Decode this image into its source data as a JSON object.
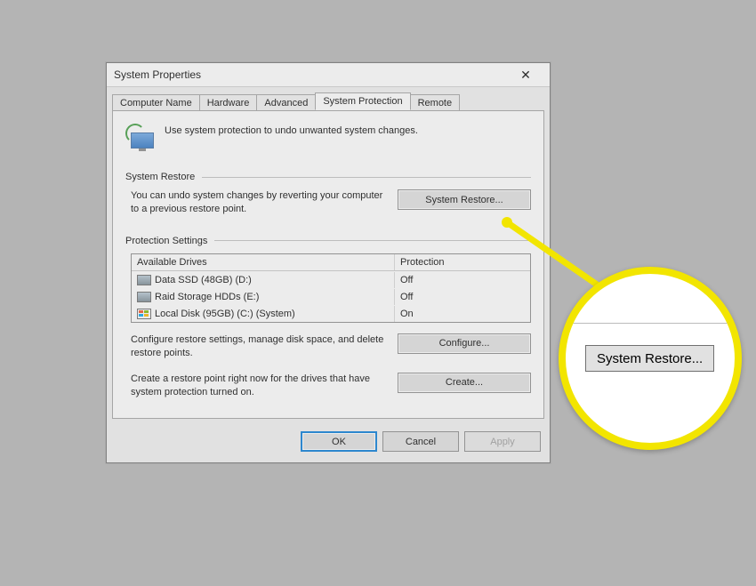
{
  "window": {
    "title": "System Properties",
    "close_aria": "Close"
  },
  "tabs": [
    {
      "label": "Computer Name",
      "active": false
    },
    {
      "label": "Hardware",
      "active": false
    },
    {
      "label": "Advanced",
      "active": false
    },
    {
      "label": "System Protection",
      "active": true
    },
    {
      "label": "Remote",
      "active": false
    }
  ],
  "intro": {
    "text": "Use system protection to undo unwanted system changes."
  },
  "restore": {
    "title": "System Restore",
    "desc": "You can undo system changes by reverting your computer to a previous restore point.",
    "button": "System Restore..."
  },
  "protection": {
    "title": "Protection Settings",
    "headers": {
      "drives": "Available Drives",
      "prot": "Protection"
    },
    "drives": [
      {
        "icon": "hdd",
        "name": "Data SSD (48GB) (D:)",
        "prot": "Off"
      },
      {
        "icon": "hdd",
        "name": "Raid Storage HDDs (E:)",
        "prot": "Off"
      },
      {
        "icon": "win",
        "name": "Local Disk (95GB) (C:) (System)",
        "prot": "On"
      }
    ],
    "configure": {
      "desc": "Configure restore settings, manage disk space, and delete restore points.",
      "button": "Configure..."
    },
    "create": {
      "desc": "Create a restore point right now for the drives that have system protection turned on.",
      "button": "Create..."
    }
  },
  "buttons": {
    "ok": "OK",
    "cancel": "Cancel",
    "apply": "Apply"
  },
  "magnifier": {
    "label": "System Restore..."
  }
}
